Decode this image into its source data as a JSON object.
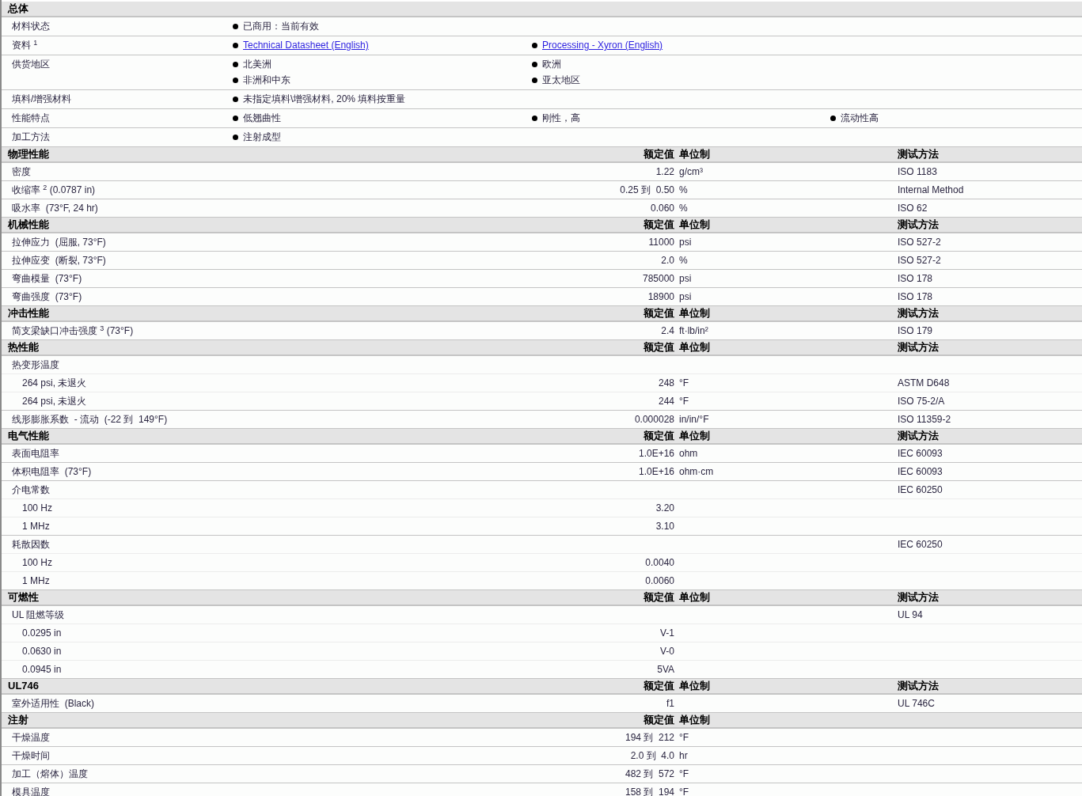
{
  "sections": [
    {
      "title": "总体",
      "rows": [
        {
          "kind": "general",
          "label": "材料状态",
          "lines": [
            [
              {
                "text": "已商用：当前有效",
                "link": false
              }
            ]
          ]
        },
        {
          "kind": "general",
          "label": "资料 $^{1}$",
          "lines": [
            [
              {
                "text": "Technical Datasheet (English)",
                "link": true
              },
              {
                "text": "Processing - Xyron (English)",
                "link": true
              }
            ]
          ]
        },
        {
          "kind": "general",
          "label": "供货地区",
          "lines": [
            [
              {
                "text": "北美洲",
                "link": false
              },
              {
                "text": "欧洲",
                "link": false
              }
            ],
            [
              {
                "text": "非洲和中东",
                "link": false
              },
              {
                "text": "亚太地区",
                "link": false
              }
            ]
          ]
        },
        {
          "kind": "general",
          "label": "填料/增强材料",
          "lines": [
            [
              {
                "text": "未指定填料\\增强材料, 20% 填料按重量",
                "link": false
              }
            ]
          ]
        },
        {
          "kind": "general",
          "label": "性能特点",
          "lines": [
            [
              {
                "text": "低翘曲性",
                "link": false
              },
              {
                "text": "刚性，高",
                "link": false
              },
              {
                "text": "流动性高",
                "link": false
              }
            ]
          ]
        },
        {
          "kind": "general",
          "label": "加工方法",
          "lines": [
            [
              {
                "text": "注射成型",
                "link": false
              }
            ]
          ]
        }
      ]
    },
    {
      "title": "物理性能",
      "columns": [
        "额定值",
        "单位制",
        "测试方法"
      ],
      "rows": [
        {
          "kind": "property",
          "label": "密度",
          "value": "1.22",
          "unit": "g/cm³",
          "method": "ISO 1183"
        },
        {
          "kind": "property",
          "label": "收缩率 $^{2}$ (0.0787 in)",
          "value": "0.25 到  0.50",
          "unit": "%",
          "method": "Internal Method"
        },
        {
          "kind": "property",
          "label": "吸水率  (73°F, 24 hr)",
          "value": "0.060",
          "unit": "%",
          "method": "ISO 62"
        }
      ]
    },
    {
      "title": "机械性能",
      "columns": [
        "额定值",
        "单位制",
        "测试方法"
      ],
      "rows": [
        {
          "kind": "property",
          "label": "拉伸应力  (屈服, 73°F)",
          "value": "11000",
          "unit": "psi",
          "method": "ISO 527-2"
        },
        {
          "kind": "property",
          "label": "拉伸应变  (断裂, 73°F)",
          "value": "2.0",
          "unit": "%",
          "method": "ISO 527-2"
        },
        {
          "kind": "property",
          "label": "弯曲模量  (73°F)",
          "value": "785000",
          "unit": "psi",
          "method": "ISO 178"
        },
        {
          "kind": "property",
          "label": "弯曲强度  (73°F)",
          "value": "18900",
          "unit": "psi",
          "method": "ISO 178"
        }
      ]
    },
    {
      "title": "冲击性能",
      "columns": [
        "额定值",
        "单位制",
        "测试方法"
      ],
      "rows": [
        {
          "kind": "property",
          "label": "简支梁缺口冲击强度 $^{3}$ (73°F)",
          "value": "2.4",
          "unit": "ft·lb/in²",
          "method": "ISO 179"
        }
      ]
    },
    {
      "title": "热性能",
      "columns": [
        "额定值",
        "单位制",
        "测试方法"
      ],
      "rows": [
        {
          "kind": "property",
          "label": "热变形温度",
          "children": [
            {
              "label": "264 psi, 未退火",
              "value": "248",
              "unit": "°F",
              "method": "ASTM D648"
            },
            {
              "label": "264 psi, 未退火",
              "value": "244",
              "unit": "°F",
              "method": "ISO 75-2/A"
            }
          ]
        },
        {
          "kind": "property",
          "label": "线形膨胀系数  - 流动  (-22 到  149°F)",
          "value": "0.000028",
          "unit": "in/in/°F",
          "method": "ISO 11359-2"
        }
      ]
    },
    {
      "title": "电气性能",
      "columns": [
        "额定值",
        "单位制",
        "测试方法"
      ],
      "rows": [
        {
          "kind": "property",
          "label": "表面电阻率",
          "value": "1.0E+16",
          "unit": "ohm",
          "method": "IEC 60093"
        },
        {
          "kind": "property",
          "label": "体积电阻率  (73°F)",
          "value": "1.0E+16",
          "unit": "ohm·cm",
          "method": "IEC 60093"
        },
        {
          "kind": "property",
          "label": "介电常数",
          "method": "IEC 60250",
          "children": [
            {
              "label": "100 Hz",
              "value": "3.20"
            },
            {
              "label": "1 MHz",
              "value": "3.10"
            }
          ]
        },
        {
          "kind": "property",
          "label": "耗散因数",
          "method": "IEC 60250",
          "children": [
            {
              "label": "100 Hz",
              "value": "0.0040"
            },
            {
              "label": "1 MHz",
              "value": "0.0060"
            }
          ]
        }
      ]
    },
    {
      "title": "可燃性",
      "columns": [
        "额定值",
        "单位制",
        "测试方法"
      ],
      "rows": [
        {
          "kind": "property",
          "label": "UL 阻燃等级",
          "method": "UL 94",
          "children": [
            {
              "label": "0.0295 in",
              "value": "V-1"
            },
            {
              "label": "0.0630 in",
              "value": "V-0"
            },
            {
              "label": "0.0945 in",
              "value": "5VA"
            }
          ]
        }
      ]
    },
    {
      "title": "UL746",
      "columns": [
        "额定值",
        "单位制",
        "测试方法"
      ],
      "rows": [
        {
          "kind": "property",
          "label": "室外适用性  (Black)",
          "value": "f1",
          "method": "UL 746C"
        }
      ]
    },
    {
      "title": "注射",
      "columns": [
        "额定值",
        "单位制"
      ],
      "rows": [
        {
          "kind": "property",
          "label": "干燥温度",
          "value": "194 到  212",
          "unit": "°F"
        },
        {
          "kind": "property",
          "label": "干燥时间",
          "value": "2.0 到  4.0",
          "unit": "hr"
        },
        {
          "kind": "property",
          "label": "加工（熔体）温度",
          "value": "482 到  572",
          "unit": "°F"
        },
        {
          "kind": "property",
          "label": "模具温度",
          "value": "158 到  194",
          "unit": "°F"
        }
      ]
    }
  ]
}
